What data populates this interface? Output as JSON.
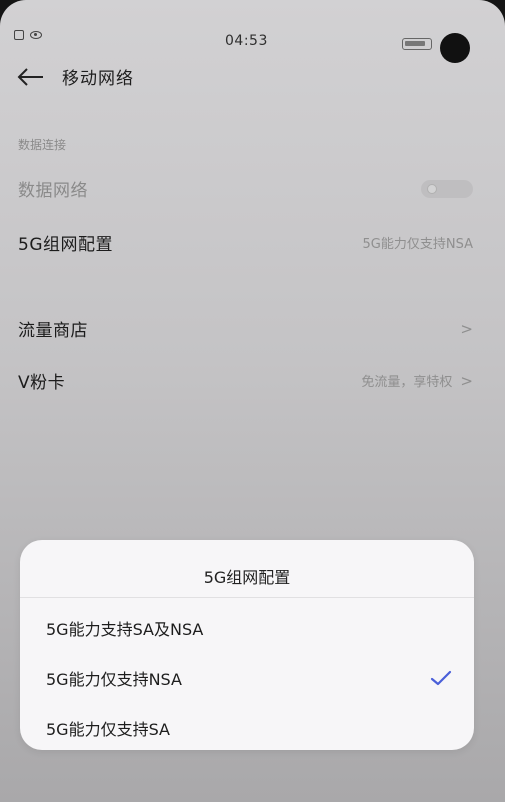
{
  "status_bar": {
    "time": "04:53"
  },
  "header": {
    "title": "移动网络"
  },
  "section": {
    "label": "数据连接"
  },
  "rows": {
    "data_network": {
      "label": "数据网络"
    },
    "network_config": {
      "label": "5G组网配置",
      "value": "5G能力仅支持NSA"
    },
    "traffic_store": {
      "label": "流量商店"
    },
    "v_card": {
      "label": "V粉卡",
      "value": "免流量，享特权"
    }
  },
  "dialog": {
    "title": "5G组网配置",
    "options": [
      {
        "label": "5G能力支持SA及NSA",
        "selected": false
      },
      {
        "label": "5G能力仅支持NSA",
        "selected": true
      },
      {
        "label": "5G能力仅支持SA",
        "selected": false
      }
    ]
  },
  "colors": {
    "accent": "#4a5fd9"
  }
}
